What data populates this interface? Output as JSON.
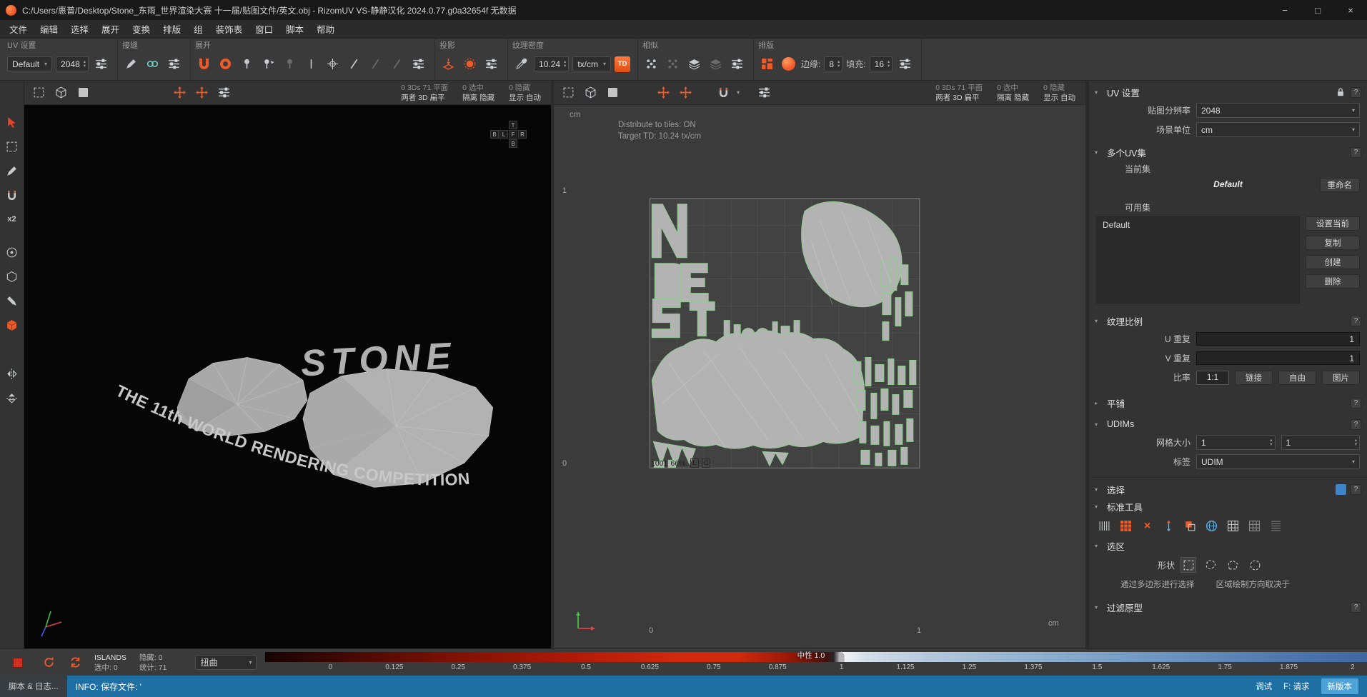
{
  "titlebar": {
    "title": "C:/Users/惠普/Desktop/Stone_东雨_世界渲染大赛 十一届/贴图文件/英文.obj - RizomUV  VS-静静汉化 2024.0.77.g0a32654f 无数据",
    "minimize": "−",
    "maximize": "□",
    "close": "×"
  },
  "menubar": {
    "items": [
      "文件",
      "编辑",
      "选择",
      "展开",
      "变换",
      "排版",
      "组",
      "装饰表",
      "窗口",
      "脚本",
      "帮助"
    ]
  },
  "toolbar": {
    "uv_settings": {
      "label": "UV 设置",
      "preset": "Default",
      "resolution": "2048"
    },
    "seams": {
      "label": "接缝"
    },
    "unfold": {
      "label": "展开"
    },
    "projection": {
      "label": "投影"
    },
    "texel_density": {
      "label": "纹理密度",
      "value": "10.24",
      "unit": "tx/cm",
      "td": "TD"
    },
    "similar": {
      "label": "相似"
    },
    "layout": {
      "label": "排版",
      "edge_label": "边缘:",
      "edge": "8",
      "fill_label": "填充:",
      "fill": "16"
    }
  },
  "left_toolbar": {
    "x2": "x2"
  },
  "viewport_stats": {
    "r1c1": "0 3Ds 71 平面",
    "r1c2": "0 选中",
    "r1c3": "0 隐藏",
    "r2c1": "两者 3D 扁平",
    "r2c2": "隔离 隐藏",
    "r2c3": "显示 自动"
  },
  "viewport3d": {
    "viewcube": {
      "t": "T",
      "b1": "B",
      "l": "L",
      "f": "F",
      "r": "R",
      "b2": "B"
    },
    "logo_title": "STONE",
    "logo_subtitle": "THE 11th WORLD RENDERING COMPETITION"
  },
  "viewport_uv": {
    "unit_top": "cm",
    "overlay1": "Distribute to tiles: ON",
    "overlay2": "Target TD: 10.24 tx/cm",
    "axis_left_top": "1",
    "axis_left_bottom": "0",
    "axis_bottom_left": "0",
    "axis_bottom_right": "1",
    "unit_bottom": "cm",
    "tile_id": "1001",
    "tile_pct": "66%.",
    "flag_l": "L",
    "flag_c": "C"
  },
  "right_panel": {
    "title": "UV 设置",
    "rows": {
      "resolution_label": "贴图分辨率",
      "resolution_value": "2048",
      "unit_label": "场景单位",
      "unit_value": "cm"
    },
    "uvsets": {
      "title": "多个UV集",
      "current_label": "当前集",
      "current_value": "Default",
      "rename": "重命名",
      "available_label": "可用集",
      "list_item": "Default",
      "set_current": "设置当前",
      "copy": "复制",
      "create": "创建",
      "delete": "删除"
    },
    "texture_ratio": {
      "title": "纹理比例",
      "u_label": "U 重复",
      "u_value": "1",
      "v_label": "V 重复",
      "v_value": "1",
      "ratio_label": "比率",
      "ratio_1_1": "1:1",
      "link": "链接",
      "free": "自由",
      "image": "图片"
    },
    "tiling": {
      "title": "平铺"
    },
    "udims": {
      "title": "UDIMs",
      "grid_label": "网格大小",
      "grid_x": "1",
      "grid_y": "1",
      "tag_label": "标签",
      "tag_value": "UDIM"
    },
    "select": {
      "title": "选择"
    },
    "standard_tools": {
      "title": "标准工具"
    },
    "selection": {
      "title": "选区",
      "shape_label": "形状",
      "hint1": "通过多边形进行选择",
      "hint2": "区域绘制方向取决于"
    },
    "filter": {
      "title": "过滤原型"
    }
  },
  "bottom_bar": {
    "islands": "ISLANDS",
    "selected": "选中: 0",
    "hidden": "隐藏: 0",
    "stats": "统计: 71",
    "metric": "扭曲",
    "neutral": "中性 1.0",
    "ticks": [
      "0",
      "0.125",
      "0.25",
      "0.375",
      "0.5",
      "0.625",
      "0.75",
      "0.875",
      "1",
      "1.125",
      "1.25",
      "1.375",
      "1.5",
      "1.625",
      "1.75",
      "1.875",
      "2"
    ]
  },
  "status_bar": {
    "log_tab": "脚本 & 日志...",
    "info": "INFO: 保存文件: '",
    "debug": "调试",
    "requests": "F: 请求",
    "new_version": "新版本"
  },
  "colors": {
    "accent": "#f05a28",
    "status_info_bg": "#1e6fa4",
    "island_fill": "#b3b3b3",
    "island_stroke": "#8fcc8f"
  },
  "glyphs": {
    "combo_arrow": "▾",
    "spin_up": "▴",
    "spin_down": "▾",
    "chev_open": "▾",
    "chev_closed": "▸",
    "question": "?",
    "x_mark": "×"
  }
}
